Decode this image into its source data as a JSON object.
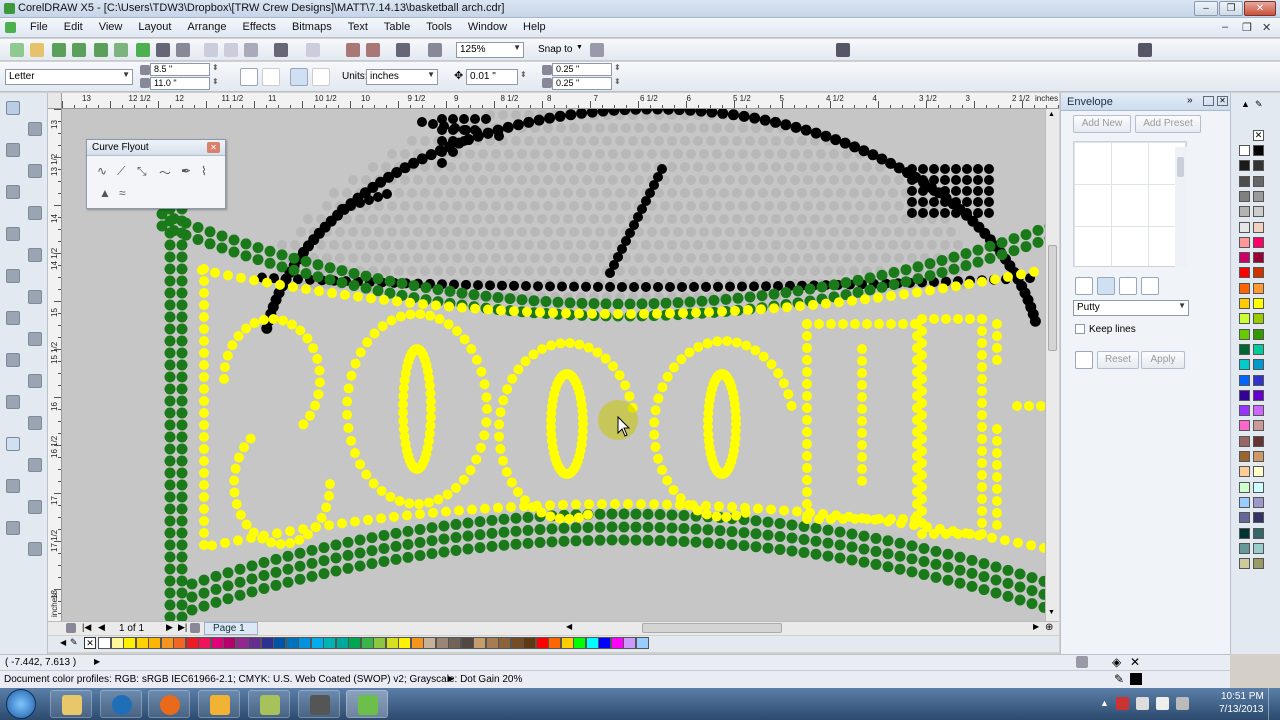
{
  "window": {
    "title": "CorelDRAW X5 - [C:\\Users\\TDW3\\Dropbox\\[TRW Crew Designs]\\MATT\\7.14.13\\basketball arch.cdr]",
    "min_label": "‒",
    "restore_label": "❐",
    "close_label": "✕"
  },
  "menu": {
    "items": [
      "File",
      "Edit",
      "View",
      "Layout",
      "Arrange",
      "Effects",
      "Bitmaps",
      "Text",
      "Table",
      "Tools",
      "Window",
      "Help"
    ]
  },
  "toolbar": {
    "zoom": "125%",
    "snap_to": "Snap to",
    "page_size": "Letter",
    "width": "8.5 \"",
    "height": "11.0 \"",
    "units_label": "Units:",
    "units_value": "inches",
    "nudge": "0.01 \"",
    "dup_x": "0.25 \"",
    "dup_y": "0.25 \""
  },
  "ruler": {
    "top_labels": [
      "13",
      "12 1/2",
      "12",
      "11 1/2",
      "11",
      "10 1/2",
      "10",
      "9 1/2",
      "9",
      "8 1/2",
      "8",
      "7",
      "6 1/2",
      "6",
      "5 1/2",
      "5",
      "4 1/2",
      "4",
      "3 1/2",
      "3",
      "2 1/2",
      "2",
      "inches"
    ],
    "left_labels": [
      "13",
      "13 1/2",
      "14",
      "14 1/2",
      "15",
      "15 1/2",
      "16",
      "16 1/2",
      "17",
      "17 1/2",
      "18",
      "inches"
    ]
  },
  "flyout": {
    "title": "Curve Flyout",
    "close_label": "✕"
  },
  "docker": {
    "title": "Envelope",
    "add_new": "Add New",
    "add_preset": "Add Preset",
    "mapping_mode": "Putty",
    "keep_lines": "Keep lines",
    "reset": "Reset",
    "apply": "Apply"
  },
  "page_nav": {
    "page_count": "1 of 1",
    "page_tab": "Page 1"
  },
  "status": {
    "coords": "( -7.442, 7.613 )",
    "color_profiles": "Document color profiles: RGB: sRGB IEC61966-2.1; CMYK: U.S. Web Coated (SWOP) v2; Grayscale: Dot Gain 20%"
  },
  "taskbar": {
    "time": "10:51 PM",
    "date": "7/13/2013"
  },
  "colors": {
    "dot_yellow": "#ffff00",
    "dot_green": "#1a7a1a",
    "dot_black": "#000000",
    "dot_gray": "#b8b8b8",
    "canvas_bg": "#c6c6c6",
    "highlight": "#c8c800"
  },
  "right_palette": [
    "#ffffff",
    "#000000",
    "#1a1a1a",
    "#333333",
    "#4d4d4d",
    "#666666",
    "#808080",
    "#999999",
    "#b3b3b3",
    "#cccccc",
    "#e6e6e6",
    "#f2d0c0",
    "#ff9999",
    "#ff0066",
    "#cc0066",
    "#990033",
    "#ff0000",
    "#cc3300",
    "#ff6600",
    "#ff9933",
    "#ffcc00",
    "#ffff00",
    "#ccff33",
    "#99cc00",
    "#66cc00",
    "#339900",
    "#006633",
    "#00cc99",
    "#00cccc",
    "#0099cc",
    "#0066ff",
    "#3333cc",
    "#330099",
    "#6600cc",
    "#9933ff",
    "#cc66ff",
    "#ff66cc",
    "#cc9999",
    "#996666",
    "#663333",
    "#996633",
    "#cc9966",
    "#ffcc99",
    "#ffffcc",
    "#ccffcc",
    "#ccffff",
    "#99ccff",
    "#9999cc",
    "#666699",
    "#333366",
    "#003333",
    "#336666",
    "#669999",
    "#99cccc",
    "#cccc99",
    "#999966"
  ],
  "bottom_palette": [
    "#ffffff",
    "#fff799",
    "#ffef00",
    "#ffd200",
    "#ffb400",
    "#f7941d",
    "#f26522",
    "#ed1c24",
    "#ee145b",
    "#e0007a",
    "#b5006b",
    "#92278f",
    "#662d91",
    "#2e3192",
    "#0054a6",
    "#0072bc",
    "#0093dd",
    "#00aeef",
    "#00b4b4",
    "#00a99d",
    "#00a651",
    "#39b54a",
    "#8dc63f",
    "#d7df23",
    "#fff200",
    "#f7941d",
    "#c7b299",
    "#998675",
    "#736357",
    "#534741",
    "#c69c6d",
    "#a67c52",
    "#8c6239",
    "#754c24",
    "#603913",
    "#ff0000",
    "#ff6600",
    "#ffcc00",
    "#00ff00",
    "#00ffff",
    "#0000ff",
    "#ff00ff",
    "#cc99ff",
    "#99ccff",
    "#66ff99",
    "#ffff99"
  ]
}
